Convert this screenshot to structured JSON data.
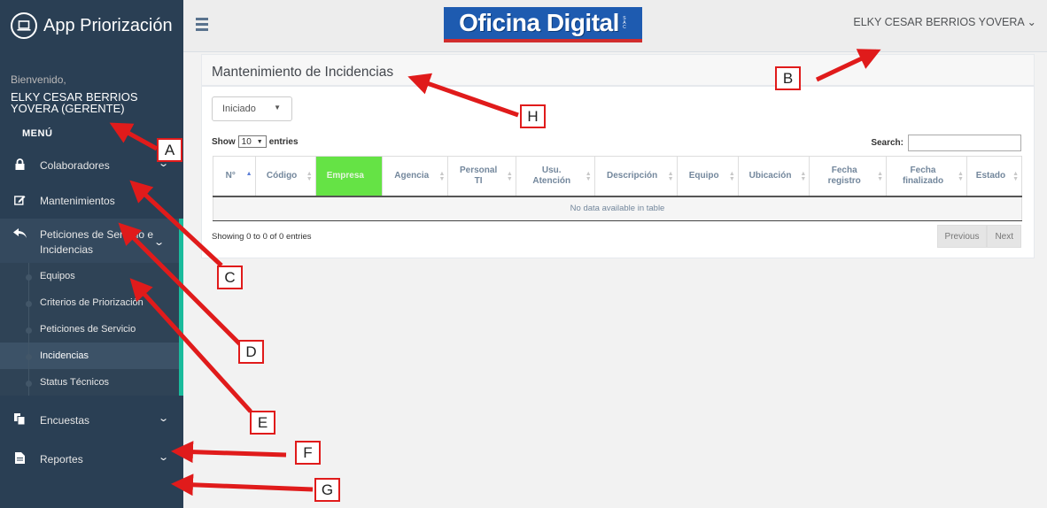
{
  "app": {
    "title": "App Priorización"
  },
  "profile": {
    "welcome": "Bienvenido,",
    "name": "ELKY CESAR BERRIOS YOVERA (GERENTE)"
  },
  "menu": {
    "heading": "MENÚ",
    "items": [
      {
        "label": "Colaboradores",
        "icon": "lock-icon"
      },
      {
        "label": "Mantenimientos",
        "icon": "edit-icon"
      },
      {
        "label": "Peticiones de Servicio e Incidencias",
        "icon": "reply-all-icon"
      },
      {
        "label": "Encuestas",
        "icon": "copy-icon"
      },
      {
        "label": "Reportes",
        "icon": "file-icon"
      }
    ],
    "sub_items": [
      {
        "label": "Equipos"
      },
      {
        "label": "Criterios de Priorización"
      },
      {
        "label": "Peticiones de Servicio"
      },
      {
        "label": "Incidencias"
      },
      {
        "label": "Status Técnicos"
      }
    ]
  },
  "header": {
    "logo_text": "Oficina Digital",
    "logo_sac": "S A C",
    "user": "ELKY CESAR BERRIOS YOVERA ⌄"
  },
  "panel": {
    "title": "Mantenimiento de Incidencias",
    "filter_value": "Iniciado",
    "show_label": "Show",
    "entries_label": "entries",
    "length_value": "10",
    "search_label": "Search:",
    "columns": [
      "N°",
      "Código",
      "Empresa",
      "Agencia",
      "Personal TI",
      "Usu. Atención",
      "Descripción",
      "Equipo",
      "Ubicación",
      "Fecha registro",
      "Fecha finalizado",
      "Estado"
    ],
    "empty_message": "No data available in table",
    "info": "Showing 0 to 0 of 0 entries",
    "prev_label": "Previous",
    "next_label": "Next"
  },
  "annotations": {
    "labels": [
      "A",
      "B",
      "C",
      "D",
      "E",
      "F",
      "G",
      "H"
    ],
    "color": "#e01b1b"
  },
  "colors": {
    "sidebar": "#2a3f54",
    "accent": "#1abb9c",
    "highlight_column": "#65e345"
  }
}
